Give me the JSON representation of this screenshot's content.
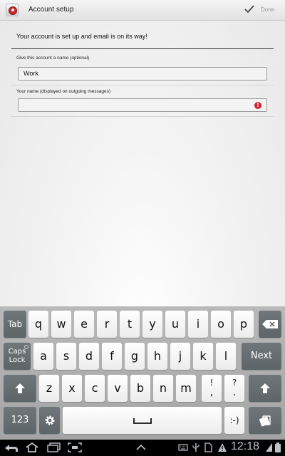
{
  "header": {
    "title": "Account setup",
    "done_label": "Done"
  },
  "content": {
    "notice": "Your account is set up and email is on its way!",
    "account_name_label": "Give this account a name (optional)",
    "account_name_value": "Work",
    "your_name_label": "Your name (displayed on outgoing messages)",
    "your_name_value": ""
  },
  "keyboard": {
    "row1": [
      "Tab",
      "q",
      "w",
      "e",
      "r",
      "t",
      "y",
      "u",
      "i",
      "o",
      "p"
    ],
    "row2": [
      "a",
      "s",
      "d",
      "f",
      "g",
      "h",
      "j",
      "k",
      "l"
    ],
    "caps_line1": "Caps",
    "caps_line2": "Lock",
    "next": "Next",
    "row3": [
      "z",
      "x",
      "c",
      "v",
      "b",
      "n",
      "m"
    ],
    "punct1_top": "!",
    "punct1_bottom": ",",
    "punct2_top": "?",
    "punct2_bottom": ".",
    "numbers": "123",
    "smiley": ":-)"
  },
  "status": {
    "time": "12:18"
  },
  "colors": {
    "accent": "#c62828",
    "error": "#d32030",
    "function_key": "#636b6e"
  }
}
